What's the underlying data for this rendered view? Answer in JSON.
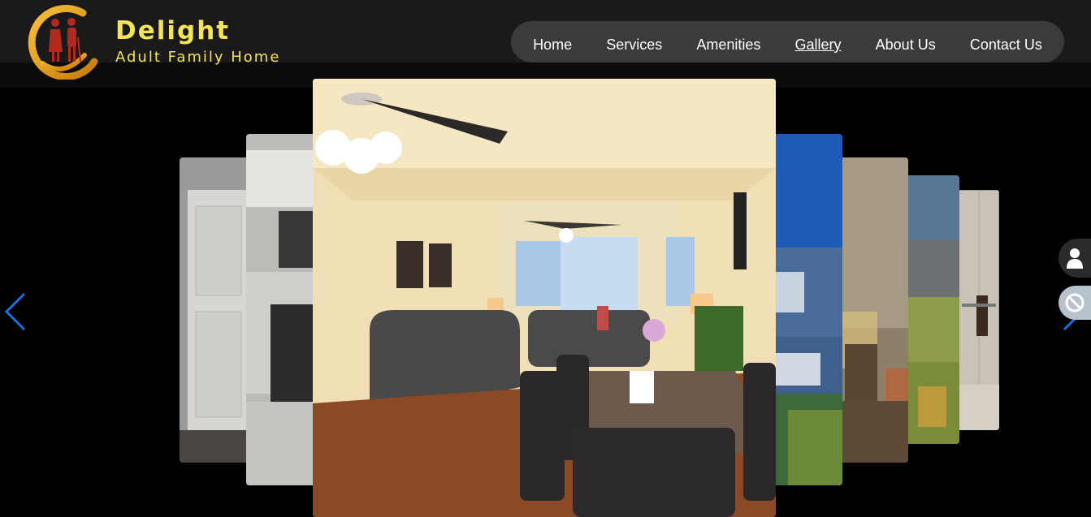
{
  "brand": {
    "name": "Delight",
    "subtitle": "Adult Family Home"
  },
  "nav": {
    "items": [
      {
        "label": "Home"
      },
      {
        "label": "Services"
      },
      {
        "label": "Amenities"
      },
      {
        "label": "Gallery",
        "active": true
      },
      {
        "label": "About Us"
      },
      {
        "label": "Contact Us"
      }
    ]
  },
  "gallery": {
    "slides": [
      {
        "name": "hallway-door-photo"
      },
      {
        "name": "kitchen-photo"
      },
      {
        "name": "living-dining-room-photo"
      },
      {
        "name": "house-exterior-photo"
      },
      {
        "name": "bedroom-photo"
      },
      {
        "name": "backyard-photo"
      },
      {
        "name": "bathroom-photo"
      }
    ],
    "active_index": 2
  },
  "icons": {
    "prev": "chevron-left-icon",
    "next": "chevron-right-icon",
    "user": "user-icon",
    "accessibility": "accessibility-icon"
  },
  "colors": {
    "brand_text": "#f4e45c",
    "nav_bg": "#3b3b3b",
    "arrow": "#1e6fe0"
  }
}
